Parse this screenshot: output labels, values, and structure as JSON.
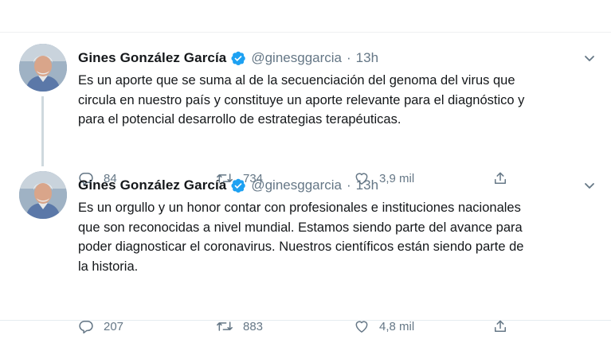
{
  "tweets": [
    {
      "author": {
        "name": "Gines González García",
        "handle": "@ginesggarcia",
        "time": "13h",
        "verified": true
      },
      "text_lines": [
        "Es un aporte que se suma al de la secuenciación del genoma del virus que",
        "circula en nuestro país y constituye un aporte relevante para el diagnóstico y",
        "para el potencial desarrollo de estrategias terapéuticas."
      ],
      "stats": {
        "replies": "84",
        "retweets": "734",
        "likes": "3,9 mil"
      }
    },
    {
      "author": {
        "name": "Gines González García",
        "handle": "@ginesggarcia",
        "time": "13h",
        "verified": true
      },
      "text_lines": [
        "Es un orgullo y un honor contar con profesionales e instituciones nacionales",
        "que son reconocidas a nivel mundial. Estamos siendo parte del avance para",
        "poder diagnosticar el coronavirus. Nuestros científicos están siendo parte de",
        "la historia."
      ],
      "stats": {
        "replies": "207",
        "retweets": "883",
        "likes": "4,8 mil"
      }
    }
  ],
  "separator": "·",
  "colors": {
    "text": "#14171a",
    "secondary": "#657786",
    "verified_badge": "#1da1f2",
    "thread_line": "#cfd9de"
  },
  "icons": [
    "reply-icon",
    "retweet-icon",
    "like-icon",
    "share-icon",
    "verified-badge-icon",
    "chevron-down-icon"
  ]
}
